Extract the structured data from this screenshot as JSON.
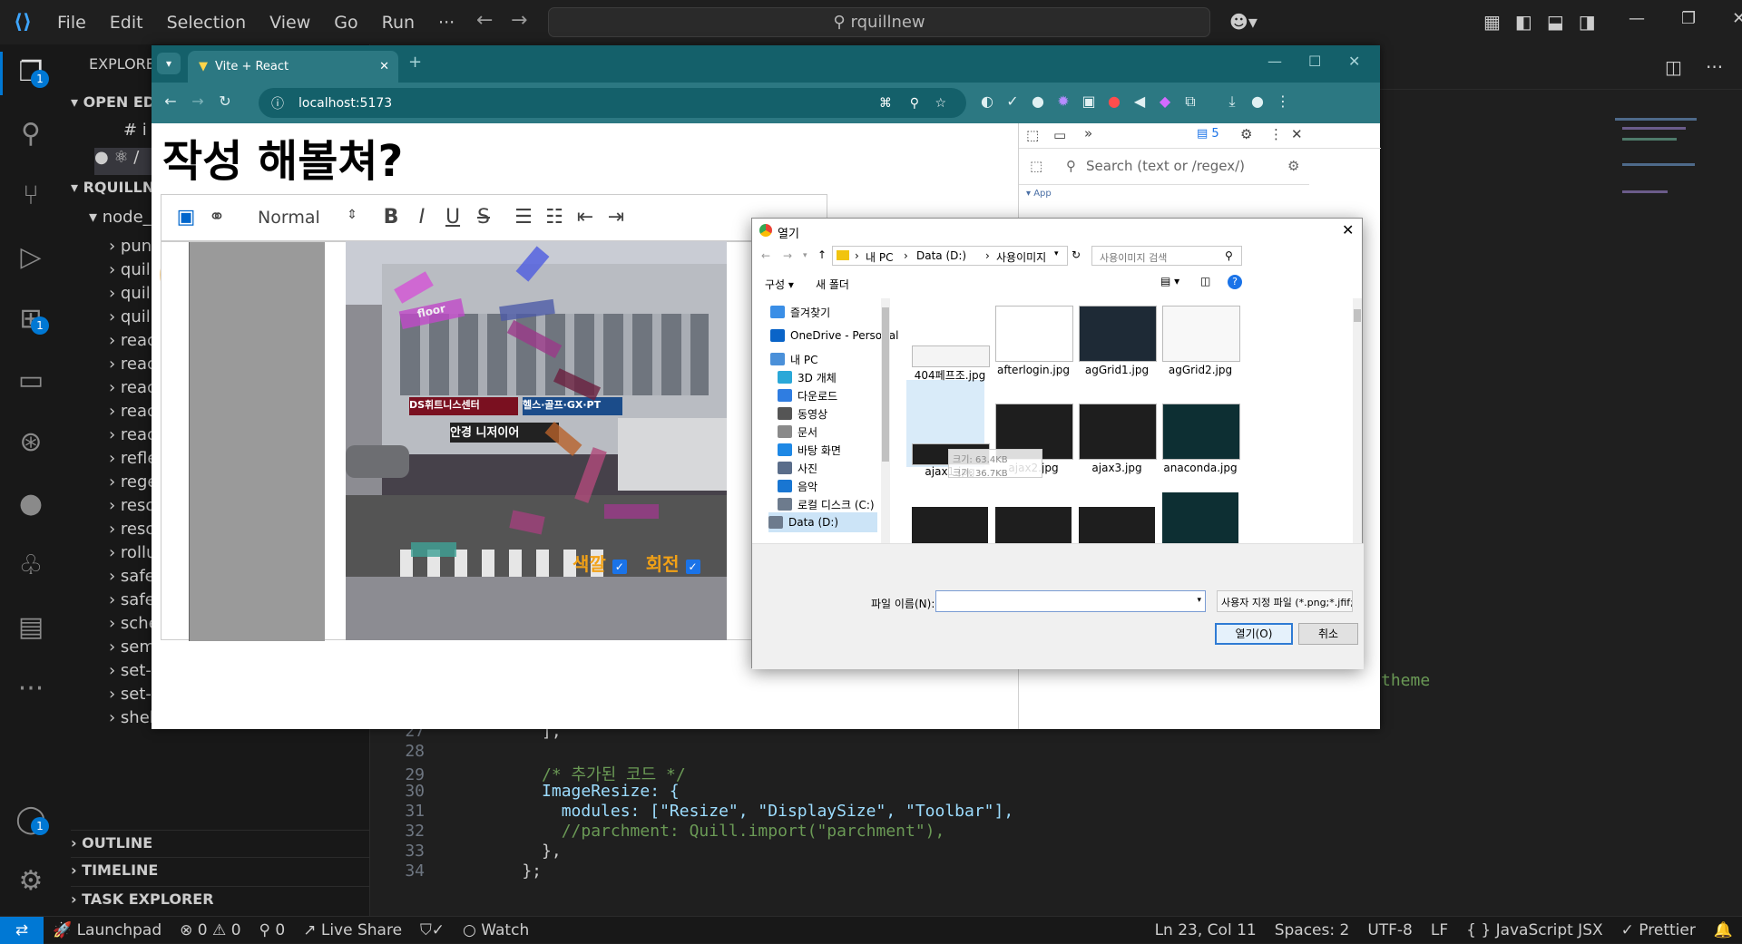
{
  "vscode": {
    "menu": [
      "File",
      "Edit",
      "Selection",
      "View",
      "Go",
      "Run",
      "···"
    ],
    "search_text": "rquillnew",
    "activity_badges": {
      "explorer": "1",
      "extensions": "1",
      "accounts": "1"
    },
    "sidebar": {
      "explorer_title": "EXPLORER",
      "open_editors": "OPEN ED",
      "project": "RQUILLN",
      "node_modules": "node_",
      "tree_items": [
        "puny",
        "quill",
        "quill",
        "quill",
        "reac",
        "reac",
        "reac",
        "reac",
        "reac",
        "refle",
        "rege",
        "reso",
        "reso",
        "rollu",
        "safe-",
        "safe-",
        "sche",
        "semver",
        "set-function-length",
        "set-function-name",
        "shebang-command"
      ],
      "sections": [
        "OUTLINE",
        "TIMELINE",
        "TASK EXPLORER"
      ]
    },
    "code": [
      {
        "n": "27",
        "text": "      ],"
      },
      {
        "n": "28",
        "text": ""
      },
      {
        "n": "29",
        "text": "      /* 추가된 코드 */"
      },
      {
        "n": "30",
        "text": "      ImageResize: {"
      },
      {
        "n": "31",
        "text": "        modules: [\"Resize\", \"DisplaySize\", \"Toolbar\"],"
      },
      {
        "n": "32",
        "text": "        //parchment: Quill.import(\"parchment\"),"
      },
      {
        "n": "33",
        "text": "      },"
      },
      {
        "n": "34",
        "text": "    };"
      }
    ],
    "code_fragment": "theme",
    "status": {
      "launchpad": "Launchpad",
      "errors": "0",
      "warnings": "0",
      "ports": "0",
      "live_share": "Live Share",
      "watch": "Watch",
      "position": "Ln 23, Col 11",
      "spaces": "Spaces: 2",
      "encoding": "UTF-8",
      "eol": "LF",
      "language": "{ } JavaScript JSX",
      "prettier": "✓ Prettier"
    }
  },
  "browser": {
    "tab_title": "Vite + React",
    "url": "localhost:5173",
    "devtools": {
      "messages": "5",
      "search_placeholder": "Search (text or /regex/)",
      "tree_item": "App"
    }
  },
  "webpage": {
    "heading": "작성 해볼쳐?",
    "format_select": "Normal",
    "photo_overlay": {
      "color_label": "색깔",
      "rotate_label": "회전"
    },
    "photo_labels": [
      "floor"
    ],
    "shop_signs": [
      "DS휘트니스센터",
      "헬스·골프·GX·PT",
      "안경 니저이어"
    ]
  },
  "dialog": {
    "title": "열기",
    "breadcrumb": [
      "내 PC",
      "Data (D:)",
      "사용이미지"
    ],
    "search_placeholder": "사용이미지 검색",
    "organize": "구성 ▾",
    "new_folder": "새 폴더",
    "nav": [
      {
        "label": "즐겨찾기",
        "color": "#3a8ee6"
      },
      {
        "label": "OneDrive - Personal",
        "color": "#0a64c8"
      },
      {
        "label": "내 PC",
        "color": "#4a90d9"
      },
      {
        "label": "3D 개체",
        "color": "#2aa8d8"
      },
      {
        "label": "다운로드",
        "color": "#2f7de1"
      },
      {
        "label": "동영상",
        "color": "#555555"
      },
      {
        "label": "문서",
        "color": "#8a8a8a"
      },
      {
        "label": "바탕 화면",
        "color": "#1e88e5"
      },
      {
        "label": "사진",
        "color": "#5a6d8a"
      },
      {
        "label": "음악",
        "color": "#1976d2"
      },
      {
        "label": "로컬 디스크 (C:)",
        "color": "#6d7b8d"
      },
      {
        "label": "Data (D:)",
        "color": "#6d7b8d"
      }
    ],
    "files": [
      "404페프조.jpg",
      "afterlogin.jpg",
      "agGrid1.jpg",
      "agGrid2.jpg",
      "ajax1.jpg",
      "ajax2.jpg",
      "ajax3.jpg",
      "anaconda.jpg"
    ],
    "tooltip": [
      "크기: 63.4KB",
      "크기: 36.7KB"
    ],
    "filename_label": "파일 이름(N):",
    "filename_value": "",
    "filter": "사용자 지정 파일 (*.png;*.jfif;*.",
    "open_button": "열기(O)",
    "cancel_button": "취소"
  }
}
